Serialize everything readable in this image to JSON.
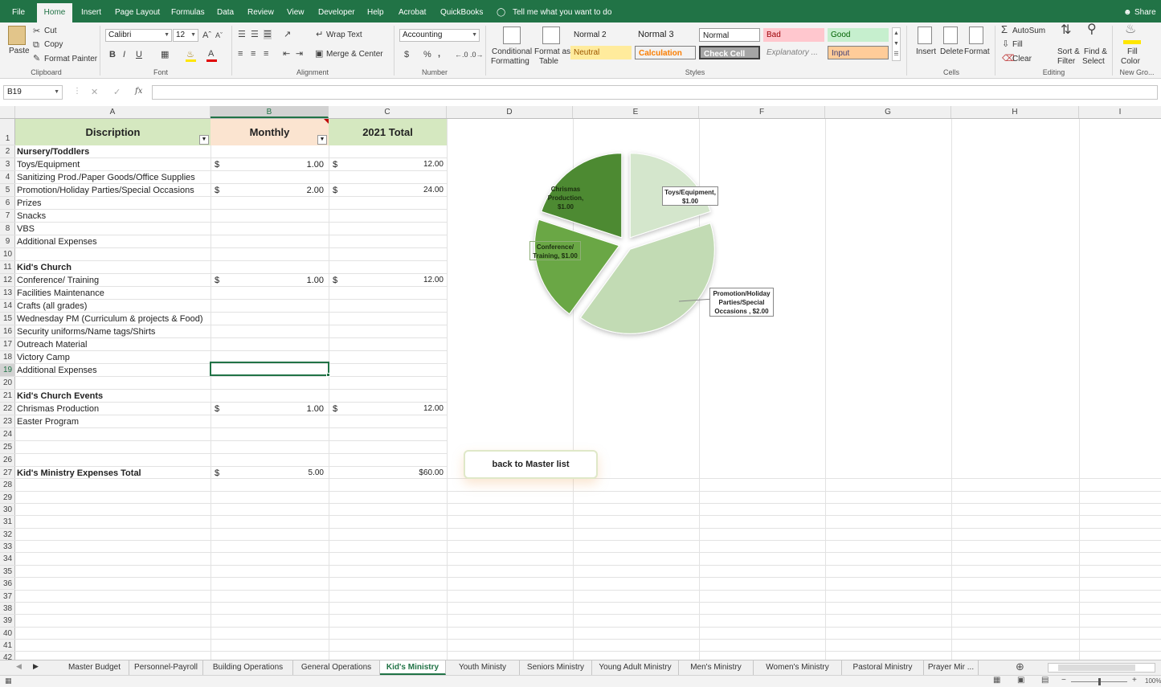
{
  "ribbon_tabs": [
    "File",
    "Home",
    "Insert",
    "Page Layout",
    "Formulas",
    "Data",
    "Review",
    "View",
    "Developer",
    "Help",
    "Acrobat",
    "QuickBooks"
  ],
  "tell_me": "Tell me what you want to do",
  "share": "Share",
  "clipboard": {
    "paste": "Paste",
    "cut": "Cut",
    "copy": "Copy",
    "format_painter": "Format Painter",
    "label": "Clipboard"
  },
  "font": {
    "name": "Calibri",
    "size": "12",
    "label": "Font",
    "bold": "B",
    "italic": "I",
    "underline": "U"
  },
  "alignment": {
    "wrap_text": "Wrap Text",
    "merge_center": "Merge & Center",
    "label": "Alignment"
  },
  "number": {
    "format": "Accounting",
    "label": "Number",
    "currency": "$",
    "percent": "%",
    "comma": ","
  },
  "styles_group": {
    "conditional_formatting": [
      "Conditional",
      "Formatting"
    ],
    "format_as_table": [
      "Format as",
      "Table"
    ],
    "cells": [
      "Normal 2",
      "Normal 3",
      "Normal",
      "Bad",
      "Good",
      "Neutral",
      "Calculation",
      "Check Cell",
      "Explanatory ...",
      "Input"
    ],
    "label": "Styles"
  },
  "cells_group": {
    "insert": "Insert",
    "delete": "Delete",
    "format": "Format",
    "label": "Cells"
  },
  "editing": {
    "autosum": "AutoSum",
    "fill": "Fill",
    "clear": "Clear",
    "sort_filter": [
      "Sort &",
      "Filter"
    ],
    "find_select": [
      "Find &",
      "Select"
    ],
    "label": "Editing"
  },
  "new_group": {
    "fill_color": [
      "Fill",
      "Color"
    ],
    "label": "New Gro..."
  },
  "name_box": "B19",
  "fx": "fx",
  "columns": [
    "A",
    "B",
    "C",
    "D",
    "E",
    "F",
    "G",
    "H",
    "I"
  ],
  "rows": [
    "1",
    "2",
    "3",
    "4",
    "5",
    "6",
    "7",
    "8",
    "9",
    "10",
    "11",
    "12",
    "13",
    "14",
    "15",
    "16",
    "17",
    "18",
    "19",
    "20",
    "21",
    "22",
    "23",
    "24",
    "25",
    "26",
    "27",
    "28",
    "29",
    "30",
    "31",
    "32",
    "33",
    "34",
    "35",
    "36",
    "37",
    "38",
    "39",
    "40",
    "41",
    "42"
  ],
  "header": {
    "a": "Discription",
    "b": "Monthly",
    "c": "2021 Total"
  },
  "table_rows": [
    {
      "a": "Nursery/Toddlers",
      "bold": true,
      "b": "",
      "c": "",
      "cs": false
    },
    {
      "a": "Toys/Equipment",
      "bold": false,
      "b": "1.00",
      "c": "12.00",
      "cs": true
    },
    {
      "a": "Sanitizing Prod./Paper Goods/Office Supplies",
      "bold": false,
      "b": "",
      "c": "",
      "cs": false
    },
    {
      "a": "Promotion/Holiday Parties/Special Occasions",
      "bold": false,
      "b": "2.00",
      "c": "24.00",
      "cs": true
    },
    {
      "a": "Prizes",
      "bold": false,
      "b": "",
      "c": "",
      "cs": false
    },
    {
      "a": "Snacks",
      "bold": false,
      "b": "",
      "c": "",
      "cs": false
    },
    {
      "a": "VBS",
      "bold": false,
      "b": "",
      "c": "",
      "cs": false
    },
    {
      "a": "Additional Expenses",
      "bold": false,
      "b": "",
      "c": "",
      "cs": false
    },
    {
      "a": "",
      "bold": false,
      "b": "",
      "c": "",
      "cs": false
    },
    {
      "a": "Kid's Church",
      "bold": true,
      "b": "",
      "c": "",
      "cs": false
    },
    {
      "a": "Conference/ Training",
      "bold": false,
      "b": "1.00",
      "c": "12.00",
      "cs": true
    },
    {
      "a": "Facilities Maintenance",
      "bold": false,
      "b": "",
      "c": "",
      "cs": false
    },
    {
      "a": "Crafts (all grades)",
      "bold": false,
      "b": "",
      "c": "",
      "cs": false
    },
    {
      "a": "Wednesday PM (Curriculum & projects & Food)",
      "bold": false,
      "b": "",
      "c": "",
      "cs": false
    },
    {
      "a": "Security uniforms/Name tags/Shirts",
      "bold": false,
      "b": "",
      "c": "",
      "cs": false
    },
    {
      "a": "Outreach Material",
      "bold": false,
      "b": "",
      "c": "",
      "cs": false
    },
    {
      "a": "Victory Camp",
      "bold": false,
      "b": "",
      "c": "",
      "cs": false
    },
    {
      "a": "Additional Expenses",
      "bold": false,
      "b": "",
      "c": "",
      "cs": false
    },
    {
      "a": "",
      "bold": false,
      "b": "",
      "c": "",
      "cs": false
    },
    {
      "a": "Kid's Church Events",
      "bold": true,
      "b": "",
      "c": "",
      "cs": false
    },
    {
      "a": "Chrismas Production",
      "bold": false,
      "b": "1.00",
      "c": "12.00",
      "cs": true
    },
    {
      "a": "Easter Program",
      "bold": false,
      "b": "",
      "c": "",
      "cs": false
    },
    {
      "a": "",
      "bold": false,
      "b": "",
      "c": "",
      "cs": false
    },
    {
      "a": "",
      "bold": false,
      "b": "",
      "c": "",
      "cs": false
    },
    {
      "a": "",
      "bold": false,
      "b": "",
      "c": "",
      "cs": false
    },
    {
      "a": "Kid's Ministry Expenses Total",
      "bold": true,
      "b": "5.00",
      "c": "$60.00",
      "cs": false
    }
  ],
  "dollar": "$",
  "back_button": "back to Master list",
  "chart_data": {
    "type": "pie",
    "slices": [
      {
        "label": "Toys/Equipment,",
        "value_label": "$1.00",
        "value": 1,
        "color": "#d4e6cc"
      },
      {
        "label": "Promotion/Holiday Parties/Special Occasions ,",
        "value_label": "$2.00",
        "value": 2,
        "color": "#c2dbb4"
      },
      {
        "label": "Conference/ Training,",
        "value_label": "$1.00",
        "value": 1,
        "color": "#6aa744"
      },
      {
        "label": "Chrismas Production,",
        "value_label": "$1.00",
        "value": 1,
        "color": "#4e8a32"
      }
    ]
  },
  "sheet_tabs": [
    "Master Budget",
    "Personnel-Payroll",
    "Building Operations",
    "General Operations",
    "Kid's Ministry",
    "Youth Ministy",
    "Seniors Ministry",
    "Young Adult Ministry",
    "Men's Ministry",
    "Women's Ministry",
    "Pastoral Ministry",
    "Prayer Mir ..."
  ],
  "active_sheet": "Kid's Ministry",
  "zoom": "100%",
  "colors": {
    "excel_green": "#217346",
    "header_green": "#d5e8c0",
    "header_peach": "#fbe4d0"
  }
}
